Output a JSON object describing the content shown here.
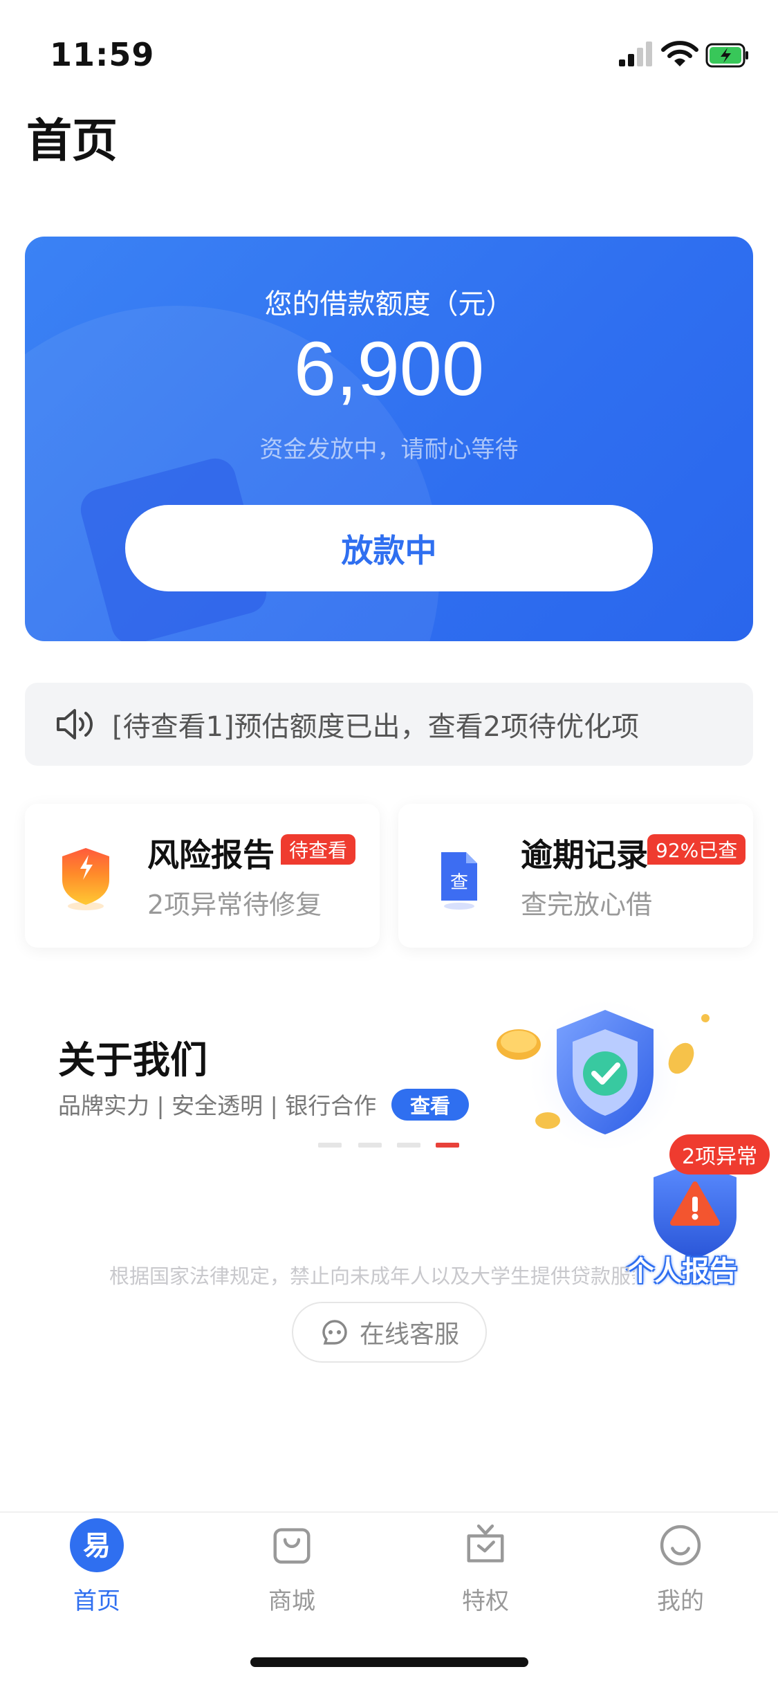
{
  "status_bar": {
    "time": "11:59"
  },
  "page_title": "首页",
  "loan_card": {
    "label": "您的借款额度（元）",
    "amount": "6,900",
    "subtitle": "资金发放中，请耐心等待",
    "button": "放款中"
  },
  "notice": {
    "text": "[待查看1]预估额度已出，查看2项待优化项"
  },
  "features": [
    {
      "title": "风险报告",
      "badge": "待查看",
      "subtitle": "2项异常待修复"
    },
    {
      "title": "逾期记录",
      "badge": "92%已查",
      "subtitle": "查完放心借",
      "icon_text": "查"
    }
  ],
  "about": {
    "title": "关于我们",
    "subtitle": "品牌实力 | 安全透明 | 银行合作",
    "button": "查看"
  },
  "carousel": {
    "count": 4,
    "active_index": 3
  },
  "float_report": {
    "badge": "2项异常",
    "label": "个人报告"
  },
  "legal_text": "根据国家法律规定，禁止向未成年人以及大学生提供贷款服务",
  "customer_service": {
    "label": "在线客服"
  },
  "tabbar": {
    "tabs": [
      {
        "label": "首页",
        "icon": "home-logo-icon",
        "active": true,
        "icon_text": "易"
      },
      {
        "label": "商城",
        "icon": "shopping-bag-icon",
        "active": false
      },
      {
        "label": "特权",
        "icon": "privilege-box-icon",
        "active": false
      },
      {
        "label": "我的",
        "icon": "smiley-profile-icon",
        "active": false
      }
    ]
  },
  "colors": {
    "primary": "#2f6ff0",
    "badge_red": "#ef3b2f",
    "text_gray": "#999999"
  }
}
